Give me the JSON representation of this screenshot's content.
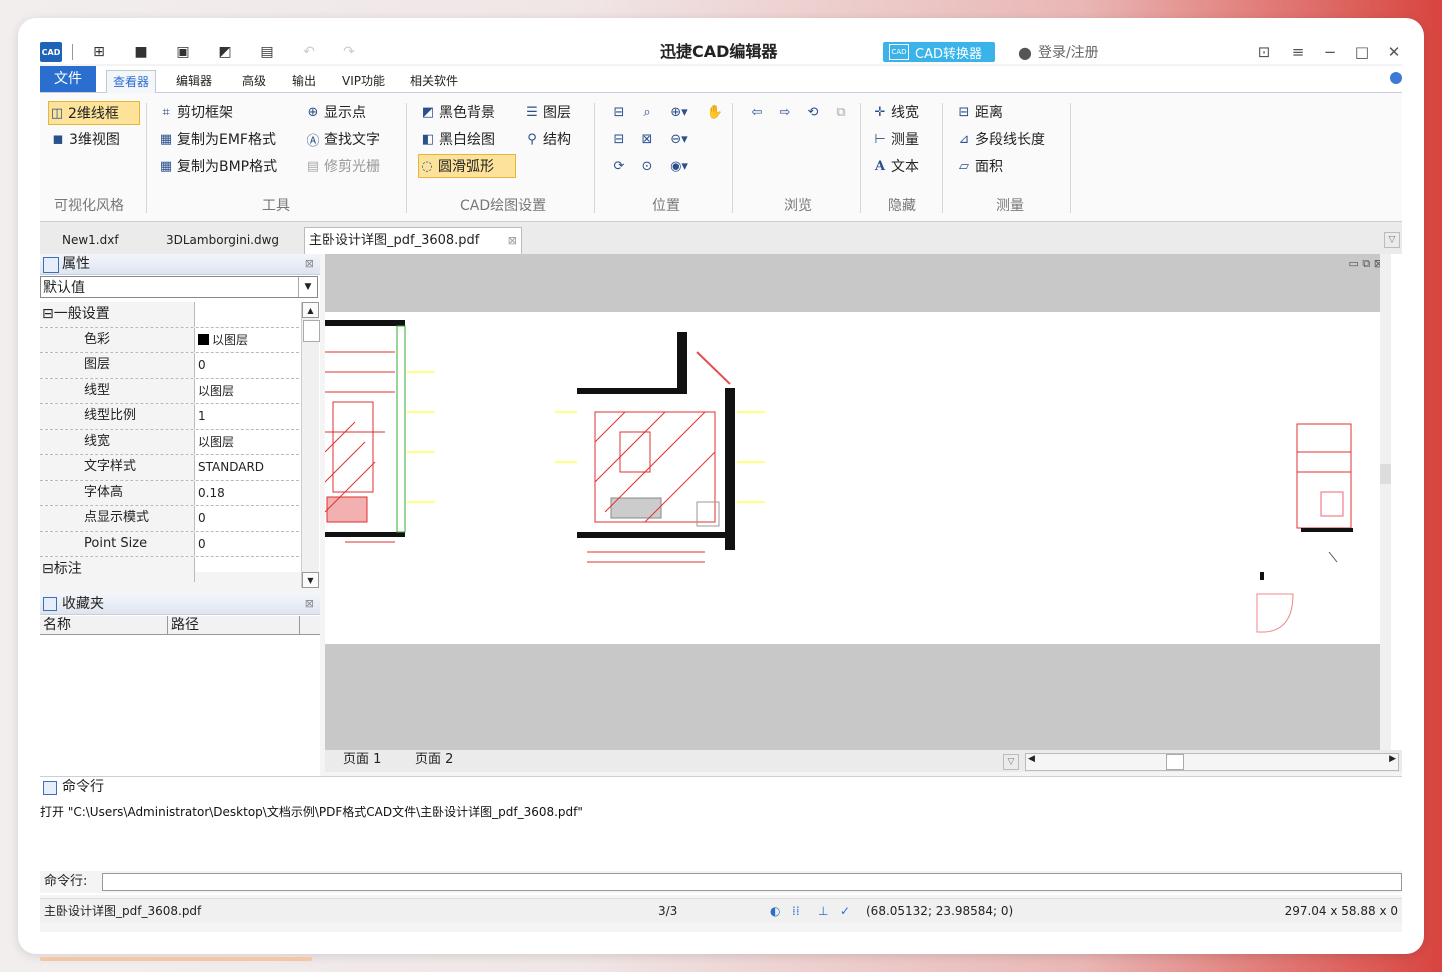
{
  "titlebar": {
    "app_title": "迅捷CAD编辑器",
    "converter_button": "CAD转换器",
    "login_link": "登录/注册",
    "icons": [
      "new-file-icon",
      "open-folder-icon",
      "save-icon",
      "export-pdf-icon",
      "print-icon",
      "undo-icon",
      "redo-icon"
    ]
  },
  "ribbon_tabs": [
    "文件",
    "查看器",
    "编辑器",
    "高级",
    "输出",
    "VIP功能",
    "相关软件"
  ],
  "ribbon": {
    "visual_style": {
      "label": "可视化风格",
      "items": [
        "2维线框",
        "3维视图"
      ]
    },
    "tools": {
      "label": "工具",
      "items": [
        "剪切框架",
        "复制为EMF格式",
        "复制为BMP格式",
        "显示点",
        "查找文字",
        "修剪光栅"
      ]
    },
    "cad_settings": {
      "label": "CAD绘图设置",
      "items": [
        "黑色背景",
        "黑白绘图",
        "圆滑弧形",
        "图层",
        "结构"
      ]
    },
    "position": {
      "label": "位置"
    },
    "browse": {
      "label": "浏览"
    },
    "hide": {
      "label": "隐藏",
      "items": [
        "线宽",
        "测量",
        "文本"
      ]
    },
    "measure": {
      "label": "测量",
      "items": [
        "距离",
        "多段线长度",
        "面积"
      ]
    }
  },
  "doc_tabs": [
    "New1.dxf",
    "3DLamborgini.dwg",
    "主卧设计详图_pdf_3608.pdf"
  ],
  "properties": {
    "title": "属性",
    "dropdown_value": "默认值",
    "category_general": "一般设置",
    "rows": [
      {
        "key": "色彩",
        "value": "以图层"
      },
      {
        "key": "图层",
        "value": "0"
      },
      {
        "key": "线型",
        "value": "以图层"
      },
      {
        "key": "线型比例",
        "value": "1"
      },
      {
        "key": "线宽",
        "value": "以图层"
      },
      {
        "key": "文字样式",
        "value": "STANDARD"
      },
      {
        "key": "字体高",
        "value": "0.18"
      },
      {
        "key": "点显示模式",
        "value": "0"
      },
      {
        "key": "Point Size",
        "value": "0"
      }
    ],
    "category_annotation": "标注"
  },
  "favorites": {
    "title": "收藏夹",
    "col_name": "名称",
    "col_path": "路径"
  },
  "pages": [
    "页面 1",
    "页面 2"
  ],
  "command": {
    "title": "命令行",
    "log": "打开 \"C:\\Users\\Administrator\\Desktop\\文档示例\\PDF格式CAD文件\\主卧设计详图_pdf_3608.pdf\"",
    "prompt_label": "命令行:"
  },
  "status": {
    "filename": "主卧设计详图_pdf_3608.pdf",
    "page": "3/3",
    "coords": "(68.05132; 23.98584; 0)",
    "size": "297.04 x 58.88 x 0"
  },
  "colors": {
    "accent": "#2a6fd0",
    "converter": "#39b3ea",
    "selected": "#fde39a"
  }
}
